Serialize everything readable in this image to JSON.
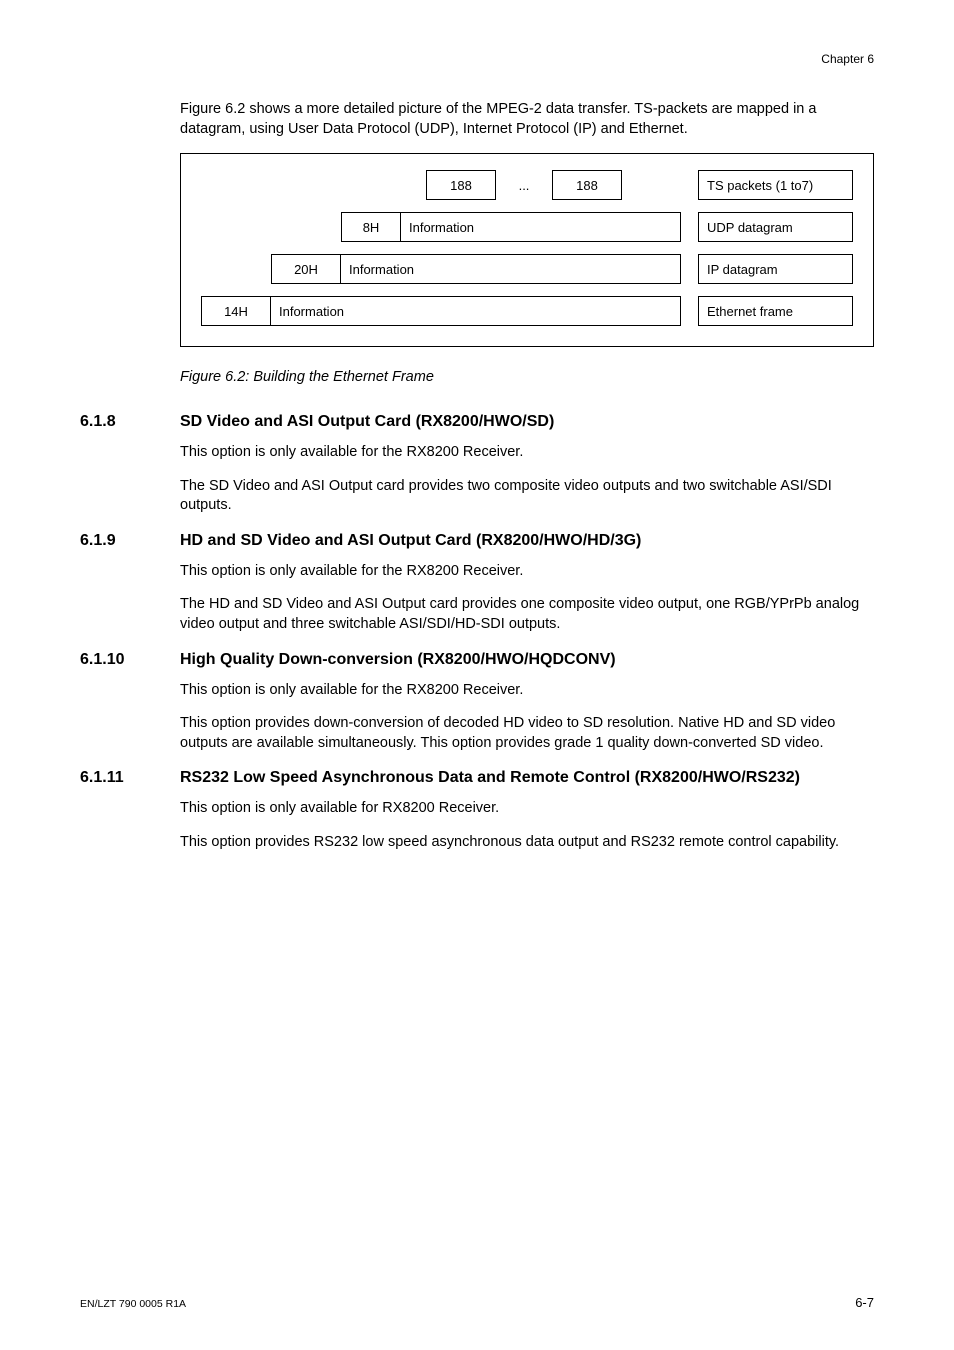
{
  "header": {
    "chapter": "Chapter 6"
  },
  "intro": "Figure 6.2 shows a more detailed picture of the MPEG-2 data transfer. TS-packets are mapped in a datagram, using User Data Protocol (UDP), Internet Protocol (IP) and Ethernet.",
  "figure": {
    "row1": {
      "c1": "188",
      "dots": "...",
      "c2": "188",
      "label": "TS packets (1 to7)"
    },
    "row2": {
      "h": "8H",
      "info": "Information",
      "label": "UDP datagram"
    },
    "row3": {
      "h": "20H",
      "info": "Information",
      "label": "IP datagram"
    },
    "row4": {
      "h": "14H",
      "info": "Information",
      "label": "Ethernet frame"
    },
    "caption": "Figure 6.2: Building the Ethernet Frame"
  },
  "sections": [
    {
      "num": "6.1.8",
      "title": "SD Video and ASI Output Card (RX8200/HWO/SD)",
      "paras": [
        "This option is only available for the RX8200 Receiver.",
        "The SD Video and ASI Output card provides two composite video outputs and two switchable ASI/SDI outputs."
      ]
    },
    {
      "num": "6.1.9",
      "title": "HD and SD Video and ASI Output Card (RX8200/HWO/HD/3G)",
      "paras": [
        "This option is only available for the RX8200 Receiver.",
        "The HD and SD Video and ASI Output card provides one composite video output, one RGB/YPrPb analog video output and three switchable ASI/SDI/HD-SDI outputs."
      ]
    },
    {
      "num": "6.1.10",
      "title": "High Quality Down-conversion (RX8200/HWO/HQDCONV)",
      "paras": [
        "This option is only available for the RX8200 Receiver.",
        "This option provides down-conversion of decoded HD video to SD resolution. Native HD and SD video outputs are available simultaneously. This option provides grade 1 quality down-converted SD video."
      ]
    },
    {
      "num": "6.1.11",
      "title": "RS232 Low Speed Asynchronous Data and Remote Control (RX8200/HWO/RS232)",
      "paras": [
        "This option is only available for RX8200 Receiver.",
        "This option provides RS232 low speed asynchronous data output and RS232 remote control capability."
      ]
    }
  ],
  "footer": {
    "left": "EN/LZT 790 0005 R1A",
    "right": "6-7"
  }
}
